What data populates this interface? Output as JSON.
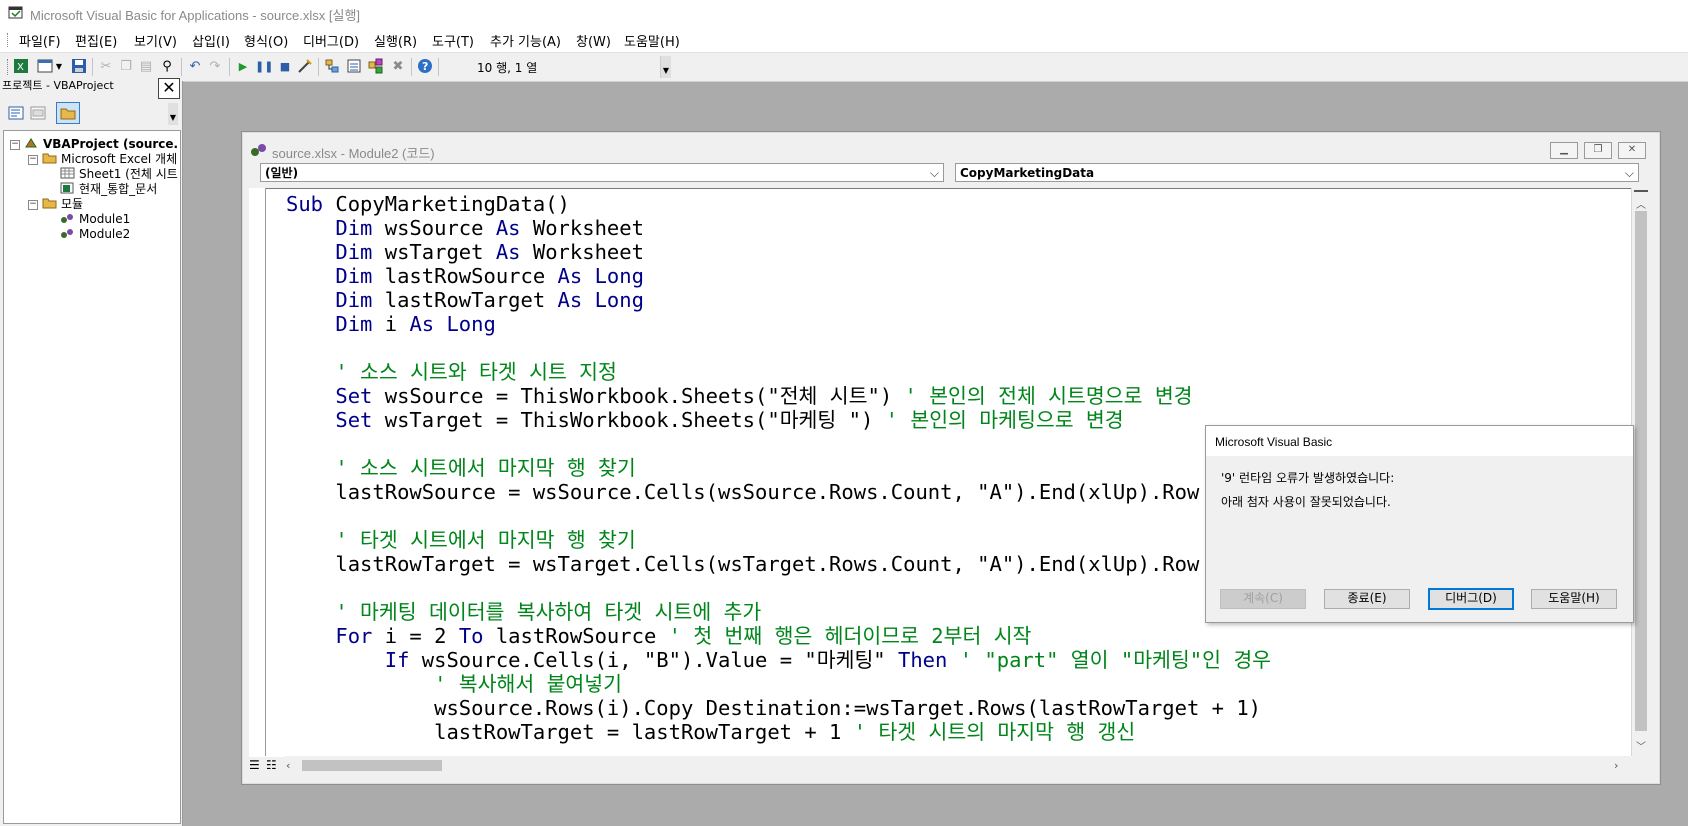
{
  "app": {
    "title": "Microsoft Visual Basic for Applications - source.xlsx [실행]"
  },
  "menu": [
    "파일(F)",
    "편집(E)",
    "보기(V)",
    "삽입(I)",
    "형식(O)",
    "디버그(D)",
    "실행(R)",
    "도구(T)",
    "추가 기능(A)",
    "창(W)",
    "도움말(H)"
  ],
  "toolbar": {
    "position": "10 행, 1 열"
  },
  "project_panel": {
    "title": "프로젝트 - VBAProject",
    "close": "✕",
    "tree": {
      "root": "VBAProject (source.",
      "excel_objects": "Microsoft Excel 개체",
      "sheet1": "Sheet1 (전체 시트",
      "workbook": "현재_통합_문서",
      "modules": "모듈",
      "module1": "Module1",
      "module2": "Module2"
    }
  },
  "code_window": {
    "title": "source.xlsx - Module2 (코드)",
    "object_combo": "(일반)",
    "proc_combo": "CopyMarketingData"
  },
  "code": [
    [
      {
        "t": "Sub ",
        "c": "kw"
      },
      {
        "t": "CopyMarketingData()"
      }
    ],
    [
      {
        "t": "    "
      },
      {
        "t": "Dim",
        "c": "kw"
      },
      {
        "t": " wsSource "
      },
      {
        "t": "As",
        "c": "kw"
      },
      {
        "t": " Worksheet"
      }
    ],
    [
      {
        "t": "    "
      },
      {
        "t": "Dim",
        "c": "kw"
      },
      {
        "t": " wsTarget "
      },
      {
        "t": "As",
        "c": "kw"
      },
      {
        "t": " Worksheet"
      }
    ],
    [
      {
        "t": "    "
      },
      {
        "t": "Dim",
        "c": "kw"
      },
      {
        "t": " lastRowSource "
      },
      {
        "t": "As Long",
        "c": "kw"
      }
    ],
    [
      {
        "t": "    "
      },
      {
        "t": "Dim",
        "c": "kw"
      },
      {
        "t": " lastRowTarget "
      },
      {
        "t": "As Long",
        "c": "kw"
      }
    ],
    [
      {
        "t": "    "
      },
      {
        "t": "Dim",
        "c": "kw"
      },
      {
        "t": " i "
      },
      {
        "t": "As Long",
        "c": "kw"
      }
    ],
    [],
    [
      {
        "t": "    "
      },
      {
        "t": "' 소스 시트와 타겟 시트 지정",
        "c": "cm"
      }
    ],
    [
      {
        "t": "    "
      },
      {
        "t": "Set",
        "c": "kw"
      },
      {
        "t": " wsSource = ThisWorkbook.Sheets(\"전체 시트\") "
      },
      {
        "t": "' 본인의 전체 시트명으로 변경",
        "c": "cm"
      }
    ],
    [
      {
        "t": "    "
      },
      {
        "t": "Set",
        "c": "kw"
      },
      {
        "t": " wsTarget = ThisWorkbook.Sheets(\"마케팅 \") "
      },
      {
        "t": "' 본인의 마케팅으로 변경",
        "c": "cm"
      }
    ],
    [],
    [
      {
        "t": "    "
      },
      {
        "t": "' 소스 시트에서 마지막 행 찾기",
        "c": "cm"
      }
    ],
    [
      {
        "t": "    lastRowSource = wsSource.Cells(wsSource.Rows.Count, \"A\").End(xlUp).Row"
      }
    ],
    [],
    [
      {
        "t": "    "
      },
      {
        "t": "' 타겟 시트에서 마지막 행 찾기",
        "c": "cm"
      }
    ],
    [
      {
        "t": "    lastRowTarget = wsTarget.Cells(wsTarget.Rows.Count, \"A\").End(xlUp).Row"
      }
    ],
    [],
    [
      {
        "t": "    "
      },
      {
        "t": "' 마케팅 데이터를 복사하여 타겟 시트에 추가",
        "c": "cm"
      }
    ],
    [
      {
        "t": "    "
      },
      {
        "t": "For",
        "c": "kw"
      },
      {
        "t": " i = 2 "
      },
      {
        "t": "To",
        "c": "kw"
      },
      {
        "t": " lastRowSource "
      },
      {
        "t": "' 첫 번째 행은 헤더이므로 2부터 시작",
        "c": "cm"
      }
    ],
    [
      {
        "t": "        "
      },
      {
        "t": "If",
        "c": "kw"
      },
      {
        "t": " wsSource.Cells(i, \"B\").Value = \"마케팅\" "
      },
      {
        "t": "Then",
        "c": "kw"
      },
      {
        "t": " "
      },
      {
        "t": "' \"part\" 열이 \"마케팅\"인 경우",
        "c": "cm"
      }
    ],
    [
      {
        "t": "            "
      },
      {
        "t": "' 복사해서 붙여넣기",
        "c": "cm"
      }
    ],
    [
      {
        "t": "            wsSource.Rows(i).Copy Destination:=wsTarget.Rows(lastRowTarget + 1)"
      }
    ],
    [
      {
        "t": "            lastRowTarget = lastRowTarget + 1 "
      },
      {
        "t": "' 타겟 시트의 마지막 행 갱신",
        "c": "cm"
      }
    ]
  ],
  "dialog": {
    "title": "Microsoft Visual Basic",
    "line1": "'9' 런타임 오류가 발생하였습니다:",
    "line2": "아래 첨자 사용이 잘못되었습니다.",
    "btn_continue": "계속(C)",
    "btn_end": "종료(E)",
    "btn_debug": "디버그(D)",
    "btn_help": "도움말(H)"
  },
  "colors": {
    "keyword": "#00008b",
    "comment": "#00851a",
    "accent": "#0078d7"
  }
}
